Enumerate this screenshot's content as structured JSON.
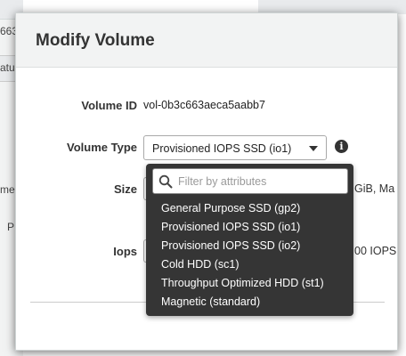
{
  "background": {
    "fragment_top": "663",
    "fragment_header": "atu",
    "fragment_left_1": "me",
    "fragment_left_2": "P"
  },
  "modal": {
    "title": "Modify Volume",
    "volume_id": {
      "label": "Volume ID",
      "value": "vol-0b3c663aeca5aabb7"
    },
    "volume_type": {
      "label": "Volume Type",
      "selected": "Provisioned IOPS SSD (io1)"
    },
    "size": {
      "label": "Size",
      "hint": "GiB, Ma"
    },
    "iops": {
      "label": "Iops",
      "hint": "00 IOPS"
    }
  },
  "dropdown": {
    "filter_placeholder": "Filter by attributes",
    "options": [
      "General Purpose SSD (gp2)",
      "Provisioned IOPS SSD (io1)",
      "Provisioned IOPS SSD (io2)",
      "Cold HDD (sc1)",
      "Throughput Optimized HDD (st1)",
      "Magnetic (standard)"
    ]
  },
  "icons": {
    "info": "info-icon",
    "search": "search-icon",
    "caret": "chevron-down-icon"
  },
  "colors": {
    "dropdown_bg": "#353535",
    "header_bg": "#f2f3f3",
    "text": "#333333"
  }
}
